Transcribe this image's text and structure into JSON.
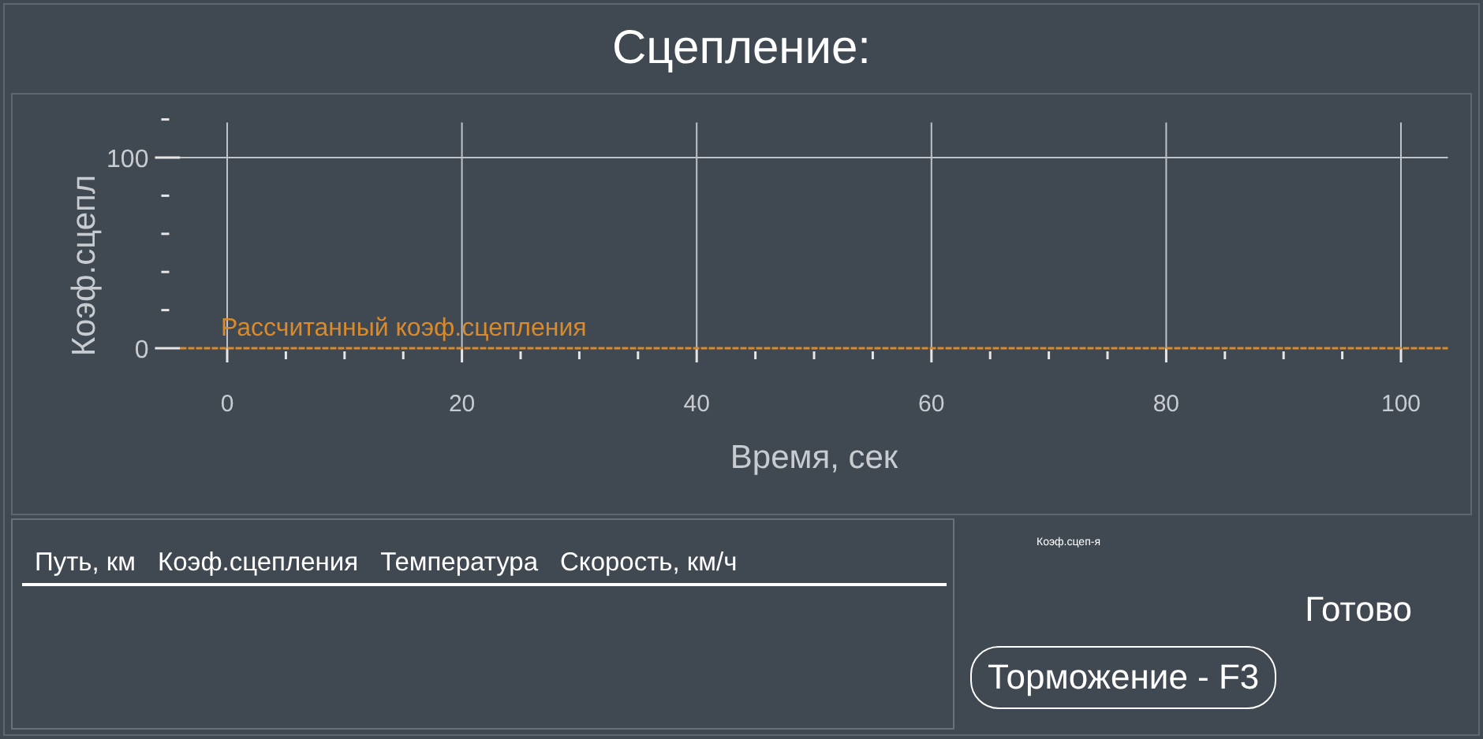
{
  "title": "Сцепление:",
  "chart": {
    "chart_data": {
      "type": "line",
      "xlabel": "Время, сек",
      "ylabel": "Коэф.сцепл",
      "x": [
        -4,
        104
      ],
      "xlim": [
        -4,
        104
      ],
      "ylim": [
        0,
        120
      ],
      "grid": true,
      "xticks": [
        0,
        20,
        40,
        60,
        80,
        100
      ],
      "yticks": [
        0,
        100
      ],
      "series": [
        {
          "name": "Рассчитанный коэф.сцепления",
          "color": "#d98a2b",
          "line_style": "dashed",
          "values": [
            0,
            0
          ]
        }
      ]
    }
  },
  "table": {
    "columns": [
      "Путь, км",
      "Коэф.сцепления",
      "Температура",
      "Скорость, км/ч"
    ]
  },
  "side": {
    "caption": "Коэф.сцеп-я",
    "status": "Готово",
    "button": "Торможение - F3"
  }
}
